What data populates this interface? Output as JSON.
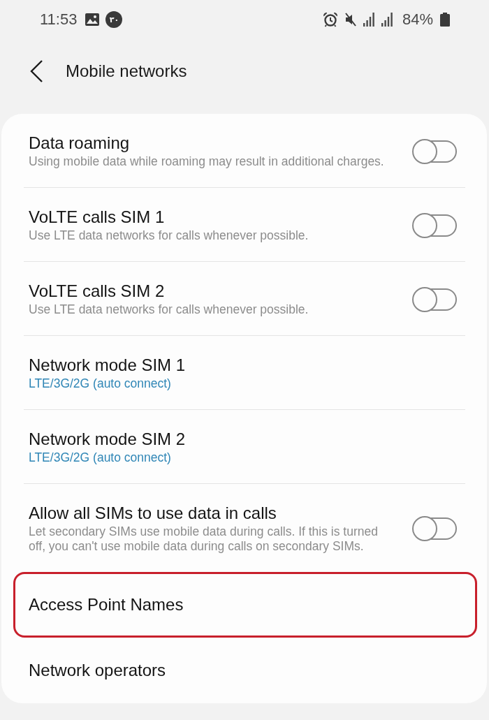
{
  "status_bar": {
    "time": "11:53",
    "notification_badge": "۳۰",
    "battery": "84%"
  },
  "header": {
    "title": "Mobile networks"
  },
  "items": [
    {
      "kind": "switch",
      "title": "Data roaming",
      "summary": "Using mobile data while roaming may result in additional charges.",
      "on": false,
      "highlighted": false,
      "divider": true
    },
    {
      "kind": "switch",
      "title": "VoLTE calls SIM 1",
      "summary": "Use LTE data networks for calls whenever possible.",
      "on": false,
      "highlighted": false,
      "divider": true
    },
    {
      "kind": "switch",
      "title": "VoLTE calls SIM 2",
      "summary": "Use LTE data networks for calls whenever possible.",
      "on": false,
      "highlighted": false,
      "divider": true
    },
    {
      "kind": "value",
      "title": "Network mode SIM 1",
      "value": "LTE/3G/2G (auto connect)",
      "highlighted": false,
      "divider": true
    },
    {
      "kind": "value",
      "title": "Network mode SIM 2",
      "value": "LTE/3G/2G (auto connect)",
      "highlighted": false,
      "divider": true
    },
    {
      "kind": "switch",
      "title": "Allow all SIMs to use data in calls",
      "summary": "Let secondary SIMs use mobile data during calls. If this is turned off, you can't use mobile data during calls on secondary SIMs.",
      "on": false,
      "highlighted": false,
      "divider": false
    },
    {
      "kind": "link",
      "title": "Access Point Names",
      "highlighted": true,
      "divider": false
    },
    {
      "kind": "link",
      "title": "Network operators",
      "highlighted": false,
      "divider": false
    }
  ]
}
